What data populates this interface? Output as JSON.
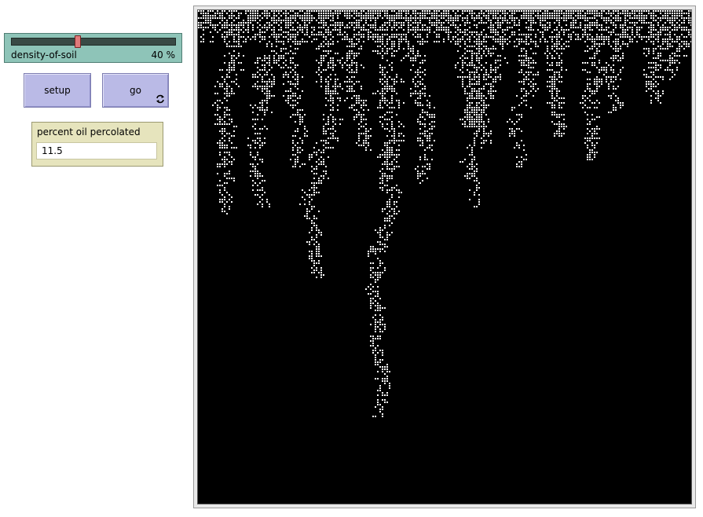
{
  "slider": {
    "label": "density-of-soil",
    "value_text": "40 %",
    "value": 40,
    "min": 0,
    "max": 100
  },
  "buttons": {
    "setup_label": "setup",
    "go_label": "go",
    "go_forever_icon": "forever-loop-icon"
  },
  "monitor": {
    "label": "percent oil percolated",
    "value": "11.5"
  },
  "world": {
    "background": "#000000",
    "pattern_color": "#ffffff"
  },
  "colors": {
    "slider_bg": "#8ec4b8",
    "button_bg": "#babae6",
    "monitor_bg": "#e6e4bd",
    "thumb": "#e07a7a"
  }
}
